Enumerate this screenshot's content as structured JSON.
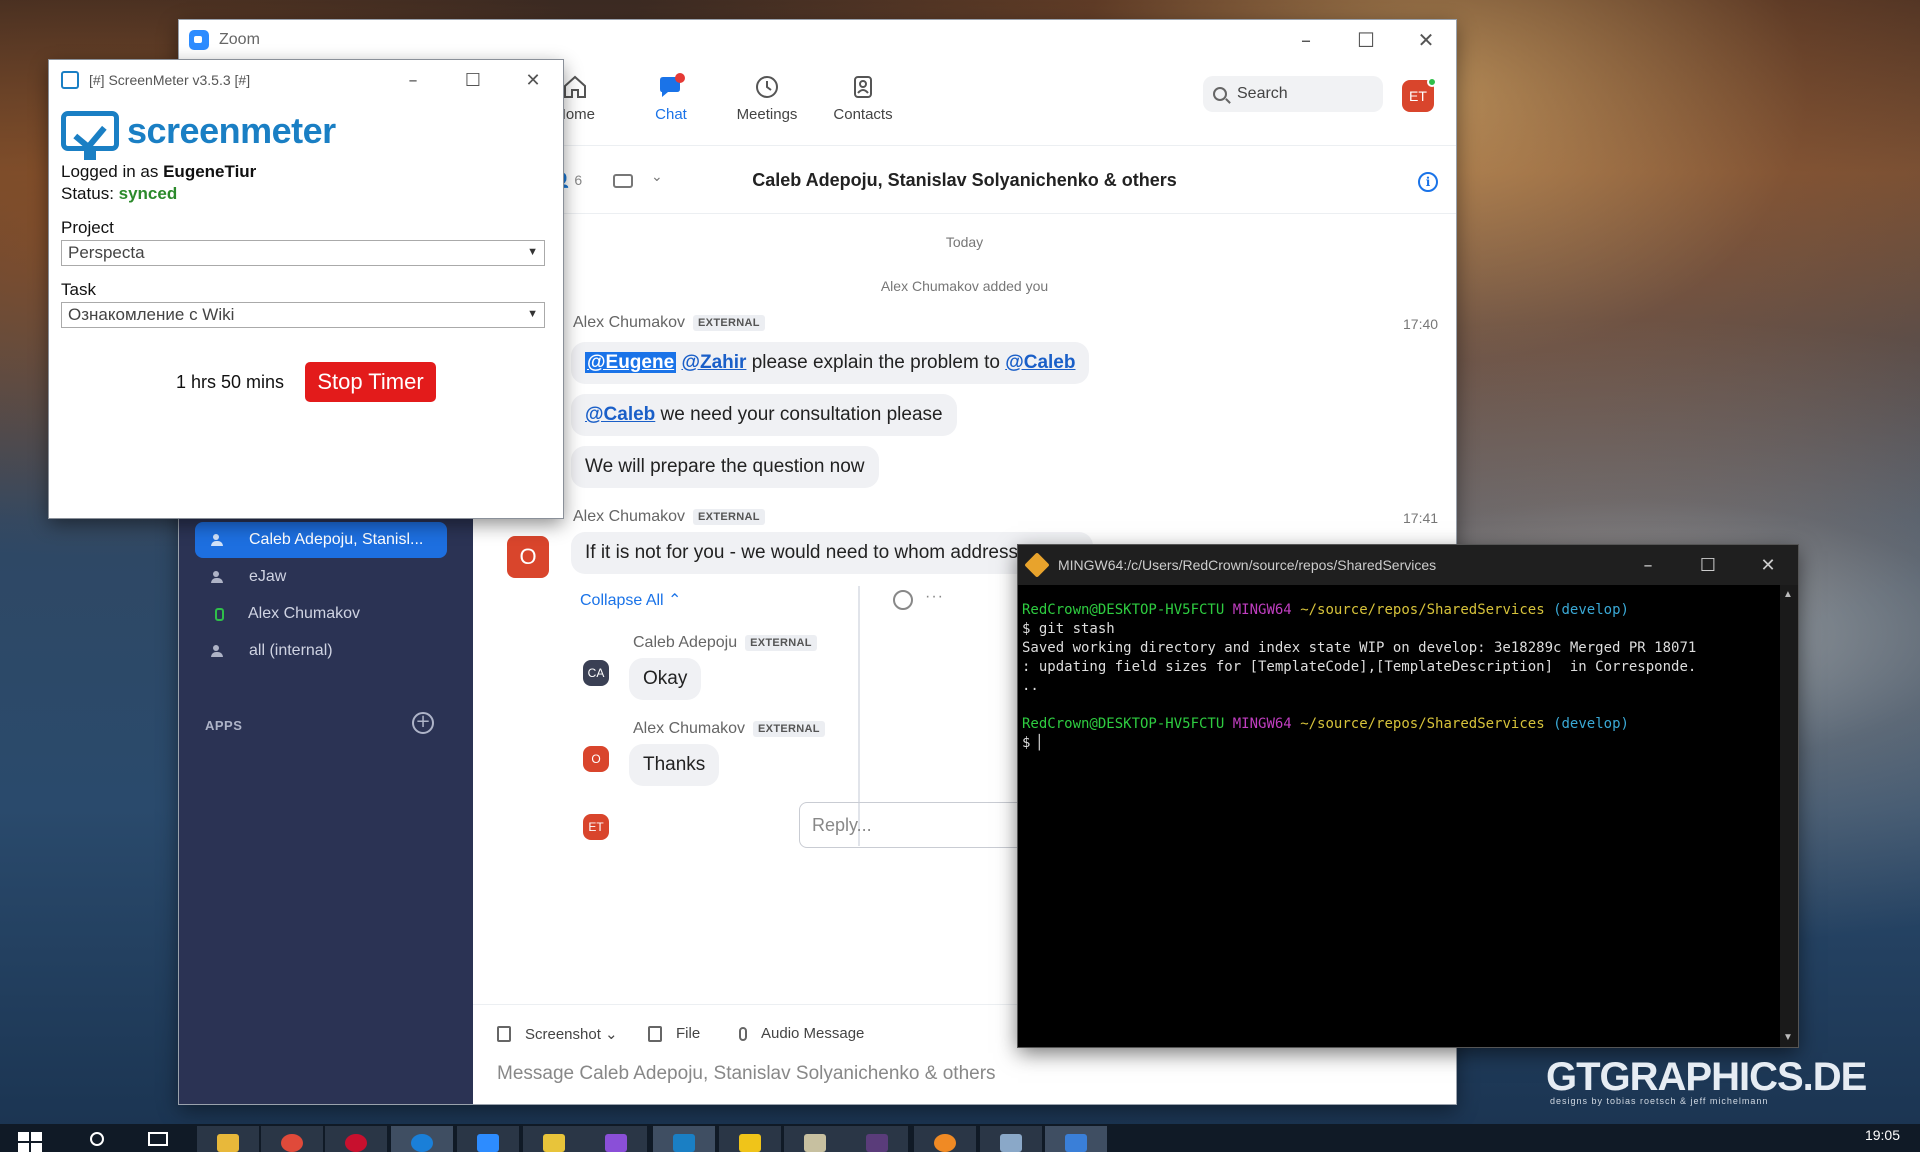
{
  "zoom": {
    "title": "Zoom",
    "nav": [
      {
        "label": "Home"
      },
      {
        "label": "Chat"
      },
      {
        "label": "Meetings"
      },
      {
        "label": "Contacts"
      }
    ],
    "search_label": "Search",
    "avatar": "ET",
    "chat": {
      "members_count": "6",
      "title": "Caleb Adepoju, Stanislav Solyanichenko & others",
      "day": "Today",
      "system": "Alex Chumakov added you",
      "external_badge": "EXTERNAL",
      "group1": {
        "sender": "Alex Chumakov",
        "time": "17:40",
        "m1": {
          "mention1": "@Eugene",
          "mention2": "@Zahir",
          "text": " please explain the problem to ",
          "mention3": "@Caleb"
        },
        "m2": {
          "mention": "@Caleb",
          "text": " we need your consultation please"
        },
        "m3": "We will prepare the question now"
      },
      "group2": {
        "sender": "Alex Chumakov",
        "time": "17:41",
        "avatar": "O",
        "text": "If it is not for you - we would need to whom address please",
        "collapse": "Collapse All ⌃",
        "replies": [
          {
            "sender": "Caleb Adepoju",
            "avatar": "CA",
            "text": "Okay"
          },
          {
            "sender": "Alex Chumakov",
            "avatar": "O",
            "text": "Thanks"
          }
        ],
        "reply_avatar": "ET",
        "reply_placeholder": "Reply..."
      },
      "compose": {
        "screenshot": "Screenshot ⌄",
        "file": "File",
        "audio": "Audio Message",
        "placeholder": "Message Caleb Adepoju, Stanislav Solyanichenko & others"
      }
    },
    "sidebar": {
      "items": [
        {
          "label": "Caleb Adepoju, Stanisl..."
        },
        {
          "label": "eJaw"
        },
        {
          "label": "Alex Chumakov"
        },
        {
          "label": "all (internal)"
        }
      ],
      "apps_label": "APPS"
    }
  },
  "screenmeter": {
    "title": "[#] ScreenMeter v3.5.3 [#]",
    "logo": "screenmeter",
    "logged_prefix": "Logged in as ",
    "user": "EugeneTiur",
    "status_prefix": "Status: ",
    "status": "synced",
    "project_label": "Project",
    "project_value": "Perspecta",
    "task_label": "Task",
    "task_value": "Ознакомление с Wiki",
    "elapsed": "1 hrs 50 mins",
    "stop_label": "Stop Timer"
  },
  "terminal": {
    "title": "MINGW64:/c/Users/RedCrown/source/repos/SharedServices",
    "user_host": "RedCrown@DESKTOP-HV5FCTU",
    "shell": "MINGW64",
    "path": "~/source/repos/SharedServices",
    "branch": "(develop)",
    "prompt": "$",
    "command": "$ git stash",
    "output1": "Saved working directory and index state WIP on develop: 3e18289c Merged PR 18071",
    "output2": ": updating field sizes for [TemplateCode],[TemplateDescription]  in Corresponde.",
    "output3": ".."
  },
  "watermark": {
    "text": "GTGRAPHICS.DE",
    "tagline": "designs by tobias roetsch & jeff michelmann"
  },
  "taskbar": {
    "clock": "19:05"
  }
}
